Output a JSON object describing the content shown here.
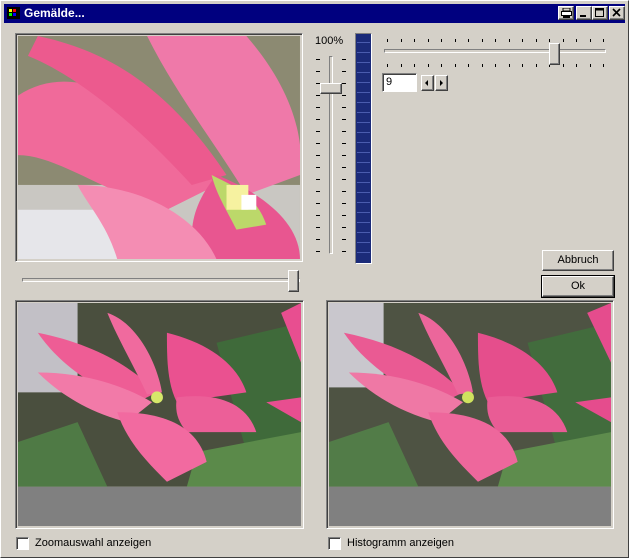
{
  "window": {
    "title": "Gemälde...",
    "colors": {
      "titlebar": "#00007f",
      "face": "#d4d0c8",
      "level_bar": "#1b2b79",
      "flower": "#ec5a8e"
    },
    "title_buttons": [
      "print-icon",
      "minimize-icon",
      "maximize-icon",
      "close-icon"
    ]
  },
  "zoom": {
    "label": "100%",
    "level_fraction": 0.86
  },
  "preview_slider": {
    "level_fraction": 1.0
  },
  "detail_slider": {
    "level_fraction": 0.78
  },
  "detail": {
    "value": "9"
  },
  "buttons": {
    "cancel": "Abbruch",
    "ok": "Ok"
  },
  "checkboxes": {
    "zoom_selection": {
      "label": "Zoomauswahl anzeigen",
      "checked": false
    },
    "histogram": {
      "label": "Histogramm anzeigen",
      "checked": false
    }
  }
}
